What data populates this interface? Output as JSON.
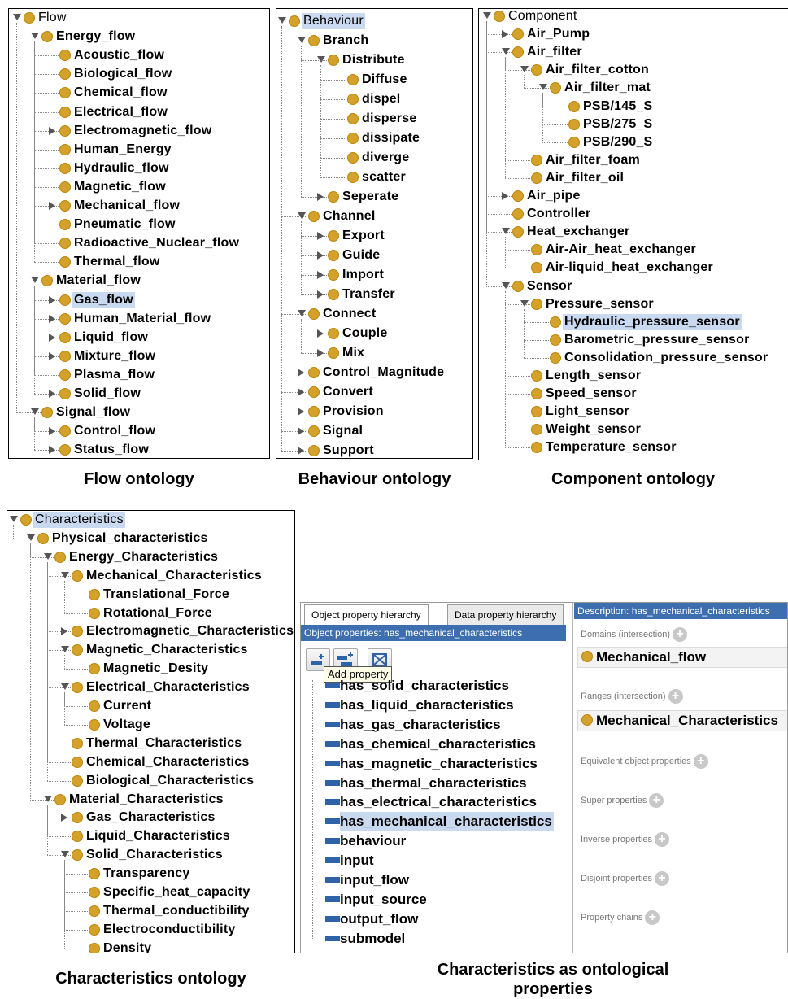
{
  "panels": {
    "flow": {
      "label": "Flow ontology",
      "nodes": [
        {
          "text": "Flow",
          "depth": 0,
          "tog": "expanded",
          "root": true
        },
        {
          "text": "Energy_flow",
          "depth": 1,
          "tog": "expanded"
        },
        {
          "text": "Acoustic_flow",
          "depth": 2,
          "tog": ""
        },
        {
          "text": "Biological_flow",
          "depth": 2,
          "tog": ""
        },
        {
          "text": "Chemical_flow",
          "depth": 2,
          "tog": ""
        },
        {
          "text": "Electrical_flow",
          "depth": 2,
          "tog": ""
        },
        {
          "text": "Electromagnetic_flow",
          "depth": 2,
          "tog": "collapsed"
        },
        {
          "text": "Human_Energy",
          "depth": 2,
          "tog": ""
        },
        {
          "text": "Hydraulic_flow",
          "depth": 2,
          "tog": ""
        },
        {
          "text": "Magnetic_flow",
          "depth": 2,
          "tog": ""
        },
        {
          "text": "Mechanical_flow",
          "depth": 2,
          "tog": "collapsed"
        },
        {
          "text": "Pneumatic_flow",
          "depth": 2,
          "tog": ""
        },
        {
          "text": "Radioactive_Nuclear_flow",
          "depth": 2,
          "tog": ""
        },
        {
          "text": "Thermal_flow",
          "depth": 2,
          "tog": ""
        },
        {
          "text": "Material_flow",
          "depth": 1,
          "tog": "expanded"
        },
        {
          "text": "Gas_flow",
          "depth": 2,
          "tog": "collapsed",
          "sel": true
        },
        {
          "text": "Human_Material_flow",
          "depth": 2,
          "tog": "collapsed"
        },
        {
          "text": "Liquid_flow",
          "depth": 2,
          "tog": "collapsed"
        },
        {
          "text": "Mixture_flow",
          "depth": 2,
          "tog": "collapsed"
        },
        {
          "text": "Plasma_flow",
          "depth": 2,
          "tog": ""
        },
        {
          "text": "Solid_flow",
          "depth": 2,
          "tog": "collapsed"
        },
        {
          "text": "Signal_flow",
          "depth": 1,
          "tog": "expanded"
        },
        {
          "text": "Control_flow",
          "depth": 2,
          "tog": "collapsed"
        },
        {
          "text": "Status_flow",
          "depth": 2,
          "tog": "collapsed"
        }
      ]
    },
    "behaviour": {
      "label": "Behaviour ontology",
      "nodes": [
        {
          "text": "Behaviour",
          "depth": 0,
          "tog": "expanded",
          "root": true,
          "sel": true
        },
        {
          "text": "Branch",
          "depth": 1,
          "tog": "expanded"
        },
        {
          "text": "Distribute",
          "depth": 2,
          "tog": "expanded"
        },
        {
          "text": "Diffuse",
          "depth": 3,
          "tog": ""
        },
        {
          "text": "dispel",
          "depth": 3,
          "tog": ""
        },
        {
          "text": "disperse",
          "depth": 3,
          "tog": ""
        },
        {
          "text": "dissipate",
          "depth": 3,
          "tog": ""
        },
        {
          "text": "diverge",
          "depth": 3,
          "tog": ""
        },
        {
          "text": "scatter",
          "depth": 3,
          "tog": ""
        },
        {
          "text": "Seperate",
          "depth": 2,
          "tog": "collapsed"
        },
        {
          "text": "Channel",
          "depth": 1,
          "tog": "expanded"
        },
        {
          "text": "Export",
          "depth": 2,
          "tog": "collapsed"
        },
        {
          "text": "Guide",
          "depth": 2,
          "tog": "collapsed"
        },
        {
          "text": "Import",
          "depth": 2,
          "tog": "collapsed"
        },
        {
          "text": "Transfer",
          "depth": 2,
          "tog": "collapsed"
        },
        {
          "text": "Connect",
          "depth": 1,
          "tog": "expanded"
        },
        {
          "text": "Couple",
          "depth": 2,
          "tog": "collapsed"
        },
        {
          "text": "Mix",
          "depth": 2,
          "tog": "collapsed"
        },
        {
          "text": "Control_Magnitude",
          "depth": 1,
          "tog": "collapsed"
        },
        {
          "text": "Convert",
          "depth": 1,
          "tog": "collapsed"
        },
        {
          "text": "Provision",
          "depth": 1,
          "tog": "collapsed"
        },
        {
          "text": "Signal",
          "depth": 1,
          "tog": "collapsed"
        },
        {
          "text": "Support",
          "depth": 1,
          "tog": "collapsed"
        }
      ]
    },
    "component": {
      "label": "Component ontology",
      "nodes": [
        {
          "text": "Component",
          "depth": 0,
          "tog": "expanded",
          "root": true
        },
        {
          "text": "Air_Pump",
          "depth": 1,
          "tog": "collapsed"
        },
        {
          "text": "Air_filter",
          "depth": 1,
          "tog": "expanded"
        },
        {
          "text": "Air_filter_cotton",
          "depth": 2,
          "tog": "expanded"
        },
        {
          "text": "Air_filter_mat",
          "depth": 3,
          "tog": "expanded"
        },
        {
          "text": "PSB/145_S",
          "depth": 4,
          "tog": ""
        },
        {
          "text": "PSB/275_S",
          "depth": 4,
          "tog": ""
        },
        {
          "text": "PSB/290_S",
          "depth": 4,
          "tog": ""
        },
        {
          "text": "Air_filter_foam",
          "depth": 2,
          "tog": ""
        },
        {
          "text": "Air_filter_oil",
          "depth": 2,
          "tog": ""
        },
        {
          "text": "Air_pipe",
          "depth": 1,
          "tog": "collapsed"
        },
        {
          "text": "Controller",
          "depth": 1,
          "tog": ""
        },
        {
          "text": "Heat_exchanger",
          "depth": 1,
          "tog": "expanded"
        },
        {
          "text": "Air-Air_heat_exchanger",
          "depth": 2,
          "tog": ""
        },
        {
          "text": "Air-liquid_heat_exchanger",
          "depth": 2,
          "tog": ""
        },
        {
          "text": "Sensor",
          "depth": 1,
          "tog": "expanded"
        },
        {
          "text": "Pressure_sensor",
          "depth": 2,
          "tog": "expanded"
        },
        {
          "text": "Hydraulic_pressure_sensor",
          "depth": 3,
          "tog": "",
          "sel": true
        },
        {
          "text": "Barometric_pressure_sensor",
          "depth": 3,
          "tog": ""
        },
        {
          "text": "Consolidation_pressure_sensor",
          "depth": 3,
          "tog": ""
        },
        {
          "text": "Length_sensor",
          "depth": 2,
          "tog": ""
        },
        {
          "text": "Speed_sensor",
          "depth": 2,
          "tog": ""
        },
        {
          "text": "Light_sensor",
          "depth": 2,
          "tog": ""
        },
        {
          "text": "Weight_sensor",
          "depth": 2,
          "tog": ""
        },
        {
          "text": "Temperature_sensor",
          "depth": 2,
          "tog": ""
        }
      ]
    },
    "characteristics": {
      "label": "Characteristics ontology",
      "nodes": [
        {
          "text": "Characteristics",
          "depth": 0,
          "tog": "expanded",
          "root": true,
          "sel": true
        },
        {
          "text": "Physical_characteristics",
          "depth": 1,
          "tog": "expanded"
        },
        {
          "text": "Energy_Characteristics",
          "depth": 2,
          "tog": "expanded"
        },
        {
          "text": "Mechanical_Characteristics",
          "depth": 3,
          "tog": "expanded"
        },
        {
          "text": "Translational_Force",
          "depth": 4,
          "tog": ""
        },
        {
          "text": "Rotational_Force",
          "depth": 4,
          "tog": ""
        },
        {
          "text": "Electromagnetic_Characteristics",
          "depth": 3,
          "tog": "collapsed"
        },
        {
          "text": "Magnetic_Characteristics",
          "depth": 3,
          "tog": "expanded"
        },
        {
          "text": "Magnetic_Desity",
          "depth": 4,
          "tog": ""
        },
        {
          "text": "Electrical_Characteristics",
          "depth": 3,
          "tog": "expanded"
        },
        {
          "text": "Current",
          "depth": 4,
          "tog": ""
        },
        {
          "text": "Voltage",
          "depth": 4,
          "tog": ""
        },
        {
          "text": "Thermal_Characteristics",
          "depth": 3,
          "tog": ""
        },
        {
          "text": "Chemical_Characteristics",
          "depth": 3,
          "tog": ""
        },
        {
          "text": "Biological_Characteristics",
          "depth": 3,
          "tog": ""
        },
        {
          "text": "Material_Characteristics",
          "depth": 2,
          "tog": "expanded"
        },
        {
          "text": "Gas_Characteristics",
          "depth": 3,
          "tog": "collapsed"
        },
        {
          "text": "Liquid_Characteristics",
          "depth": 3,
          "tog": ""
        },
        {
          "text": "Solid_Characteristics",
          "depth": 3,
          "tog": "expanded"
        },
        {
          "text": "Transparency",
          "depth": 4,
          "tog": ""
        },
        {
          "text": "Specific_heat_capacity",
          "depth": 4,
          "tog": ""
        },
        {
          "text": "Thermal_conductibility",
          "depth": 4,
          "tog": ""
        },
        {
          "text": "Electroconductibility",
          "depth": 4,
          "tog": ""
        },
        {
          "text": "Density",
          "depth": 4,
          "tog": ""
        }
      ]
    }
  },
  "properties_panel": {
    "label": "Characteristics as ontological properties",
    "tabs": [
      "Object property hierarchy",
      "Data property hierarchy"
    ],
    "list_header": "Object properties: has_mechanical_characteristics",
    "tooltip": "Add property",
    "toolbar_icons": [
      "add-subproperty-icon",
      "add-sibling-property-icon",
      "delete-property-icon"
    ],
    "properties": [
      {
        "text": "has_solid_characteristics"
      },
      {
        "text": "has_liquid_characteristics"
      },
      {
        "text": "has_gas_characteristics"
      },
      {
        "text": "has_chemical_characteristics"
      },
      {
        "text": "has_magnetic_characteristics"
      },
      {
        "text": "has_thermal_characteristics"
      },
      {
        "text": "has_electrical_characteristics"
      },
      {
        "text": "has_mechanical_characteristics",
        "sel": true
      },
      {
        "text": "behaviour"
      },
      {
        "text": "input"
      },
      {
        "text": "input_flow"
      },
      {
        "text": "input_source"
      },
      {
        "text": "output_flow"
      },
      {
        "text": "submodel"
      }
    ],
    "description": {
      "header": "Description: has_mechanical_characteristics",
      "domains_label": "Domains (intersection)",
      "domain_value": "Mechanical_flow",
      "ranges_label": "Ranges (intersection)",
      "range_value": "Mechanical_Characteristics",
      "sections": [
        "Equivalent object properties",
        "Super properties",
        "Inverse properties",
        "Disjoint properties",
        "Property chains"
      ]
    }
  },
  "colors": {
    "node_dot": "#d4a12a",
    "selection": "#c9d9ef",
    "header_blue": "#3d6fb0",
    "property_bar": "#2e63a8"
  }
}
